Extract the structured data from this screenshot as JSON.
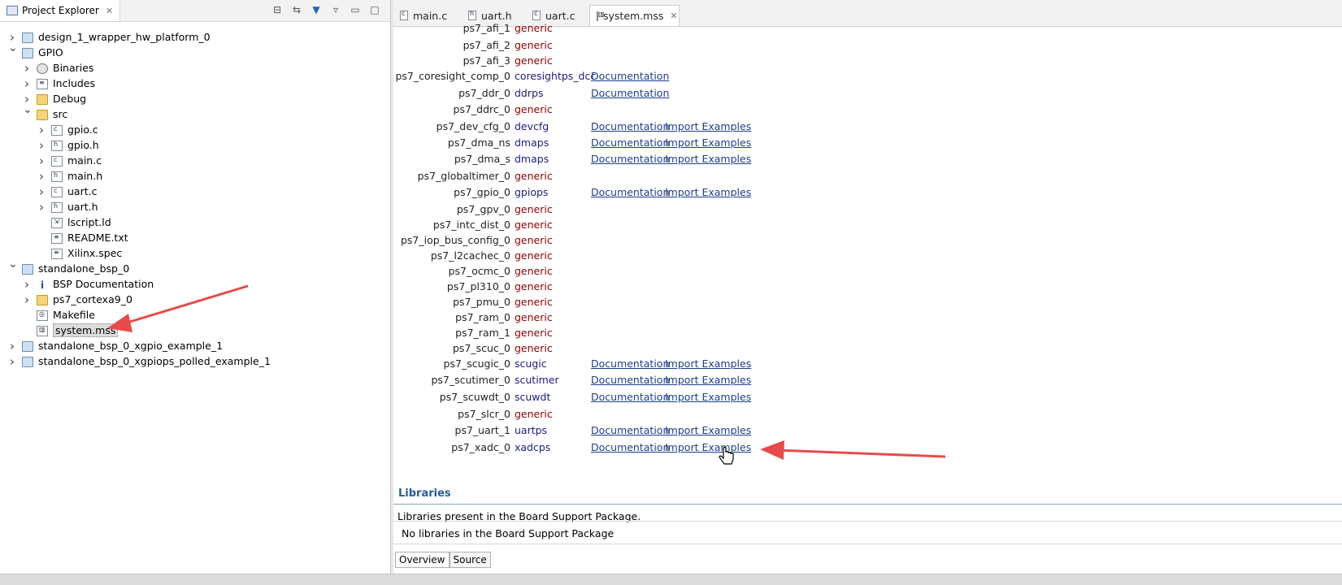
{
  "project_explorer": {
    "title": "Project Explorer",
    "close": "✕",
    "tree": [
      {
        "label": "design_1_wrapper_hw_platform_0",
        "icon": "hw-project-icon",
        "level": 0,
        "state": "collapsed"
      },
      {
        "label": "GPIO",
        "icon": "c-project-icon",
        "level": 0,
        "state": "expanded"
      },
      {
        "label": "Binaries",
        "icon": "binaries-icon",
        "level": 1,
        "state": "collapsed"
      },
      {
        "label": "Includes",
        "icon": "includes-icon",
        "level": 1,
        "state": "collapsed"
      },
      {
        "label": "Debug",
        "icon": "folder-icon",
        "level": 1,
        "state": "collapsed"
      },
      {
        "label": "src",
        "icon": "folder-icon",
        "level": 1,
        "state": "expanded"
      },
      {
        "label": "gpio.c",
        "icon": "c-file-icon",
        "level": 2,
        "state": "collapsed"
      },
      {
        "label": "gpio.h",
        "icon": "h-file-icon",
        "level": 2,
        "state": "collapsed"
      },
      {
        "label": "main.c",
        "icon": "c-file-icon",
        "level": 2,
        "state": "collapsed"
      },
      {
        "label": "main.h",
        "icon": "h-file-icon",
        "level": 2,
        "state": "collapsed"
      },
      {
        "label": "uart.c",
        "icon": "c-file-icon",
        "level": 2,
        "state": "collapsed"
      },
      {
        "label": "uart.h",
        "icon": "h-file-icon",
        "level": 2,
        "state": "collapsed"
      },
      {
        "label": "lscript.ld",
        "icon": "linker-script-icon",
        "level": 2,
        "state": "none"
      },
      {
        "label": "README.txt",
        "icon": "text-file-icon",
        "level": 2,
        "state": "none"
      },
      {
        "label": "Xilinx.spec",
        "icon": "text-file-icon",
        "level": 2,
        "state": "none"
      },
      {
        "label": "standalone_bsp_0",
        "icon": "bsp-project-icon",
        "level": 0,
        "state": "expanded"
      },
      {
        "label": "BSP Documentation",
        "icon": "info-icon",
        "level": 1,
        "state": "collapsed"
      },
      {
        "label": "ps7_cortexa9_0",
        "icon": "folder-icon",
        "level": 1,
        "state": "collapsed"
      },
      {
        "label": "Makefile",
        "icon": "makefile-icon",
        "level": 1,
        "state": "none"
      },
      {
        "label": "system.mss",
        "icon": "mss-file-icon",
        "level": 1,
        "state": "none",
        "selected": true
      },
      {
        "label": "standalone_bsp_0_xgpio_example_1",
        "icon": "c-project-icon",
        "level": 0,
        "state": "collapsed"
      },
      {
        "label": "standalone_bsp_0_xgpiops_polled_example_1",
        "icon": "c-project-icon",
        "level": 0,
        "state": "collapsed"
      }
    ]
  },
  "editor": {
    "tabs": [
      {
        "label": "main.c",
        "icon": "c"
      },
      {
        "label": "uart.h",
        "icon": "h"
      },
      {
        "label": "uart.c",
        "icon": "c"
      },
      {
        "label": "system.mss",
        "icon": "mss",
        "active": true
      }
    ],
    "close": "✕",
    "peripherals": [
      {
        "name": "ps7_afi_1",
        "driver": "generic",
        "doc": "",
        "import": ""
      },
      {
        "name": "ps7_afi_2",
        "driver": "generic",
        "doc": "",
        "import": ""
      },
      {
        "name": "ps7_afi_3",
        "driver": "generic",
        "doc": "",
        "import": ""
      },
      {
        "name": "ps7_coresight_comp_0",
        "driver": "coresightps_dcc",
        "doc": "Documentation",
        "import": ""
      },
      {
        "name": "ps7_ddr_0",
        "driver": "ddrps",
        "doc": "Documentation",
        "import": ""
      },
      {
        "name": "ps7_ddrc_0",
        "driver": "generic",
        "doc": "",
        "import": ""
      },
      {
        "name": "ps7_dev_cfg_0",
        "driver": "devcfg",
        "doc": "Documentation",
        "import": "Import Examples"
      },
      {
        "name": "ps7_dma_ns",
        "driver": "dmaps",
        "doc": "Documentation",
        "import": "Import Examples"
      },
      {
        "name": "ps7_dma_s",
        "driver": "dmaps",
        "doc": "Documentation",
        "import": "Import Examples"
      },
      {
        "name": "ps7_globaltimer_0",
        "driver": "generic",
        "doc": "",
        "import": ""
      },
      {
        "name": "ps7_gpio_0",
        "driver": "gpiops",
        "doc": "Documentation",
        "import": "Import Examples"
      },
      {
        "name": "ps7_gpv_0",
        "driver": "generic",
        "doc": "",
        "import": ""
      },
      {
        "name": "ps7_intc_dist_0",
        "driver": "generic",
        "doc": "",
        "import": ""
      },
      {
        "name": "ps7_iop_bus_config_0",
        "driver": "generic",
        "doc": "",
        "import": ""
      },
      {
        "name": "ps7_l2cachec_0",
        "driver": "generic",
        "doc": "",
        "import": ""
      },
      {
        "name": "ps7_ocmc_0",
        "driver": "generic",
        "doc": "",
        "import": ""
      },
      {
        "name": "ps7_pl310_0",
        "driver": "generic",
        "doc": "",
        "import": ""
      },
      {
        "name": "ps7_pmu_0",
        "driver": "generic",
        "doc": "",
        "import": ""
      },
      {
        "name": "ps7_ram_0",
        "driver": "generic",
        "doc": "",
        "import": ""
      },
      {
        "name": "ps7_ram_1",
        "driver": "generic",
        "doc": "",
        "import": ""
      },
      {
        "name": "ps7_scuc_0",
        "driver": "generic",
        "doc": "",
        "import": ""
      },
      {
        "name": "ps7_scugic_0",
        "driver": "scugic",
        "doc": "Documentation",
        "import": "Import Examples"
      },
      {
        "name": "ps7_scutimer_0",
        "driver": "scutimer",
        "doc": "Documentation",
        "import": "Import Examples"
      },
      {
        "name": "ps7_scuwdt_0",
        "driver": "scuwdt",
        "doc": "Documentation",
        "import": "Import Examples"
      },
      {
        "name": "ps7_slcr_0",
        "driver": "generic",
        "doc": "",
        "import": ""
      },
      {
        "name": "ps7_uart_1",
        "driver": "uartps",
        "doc": "Documentation",
        "import": "Import Examples"
      },
      {
        "name": "ps7_xadc_0",
        "driver": "xadcps",
        "doc": "Documentation",
        "import": "Import Examples"
      }
    ],
    "libraries": {
      "heading": "Libraries",
      "description": "Libraries present in the Board Support Package.",
      "empty": "No libraries in the Board Support Package"
    },
    "bottom_tabs": [
      {
        "label": "Overview",
        "active": true
      },
      {
        "label": "Source",
        "active": false
      }
    ]
  },
  "colors": {
    "accent_link": "#1c3e8e",
    "generic_driver": "#8b0000",
    "driver": "#1b1c7e",
    "annotation_arrow": "#e84a4a"
  }
}
